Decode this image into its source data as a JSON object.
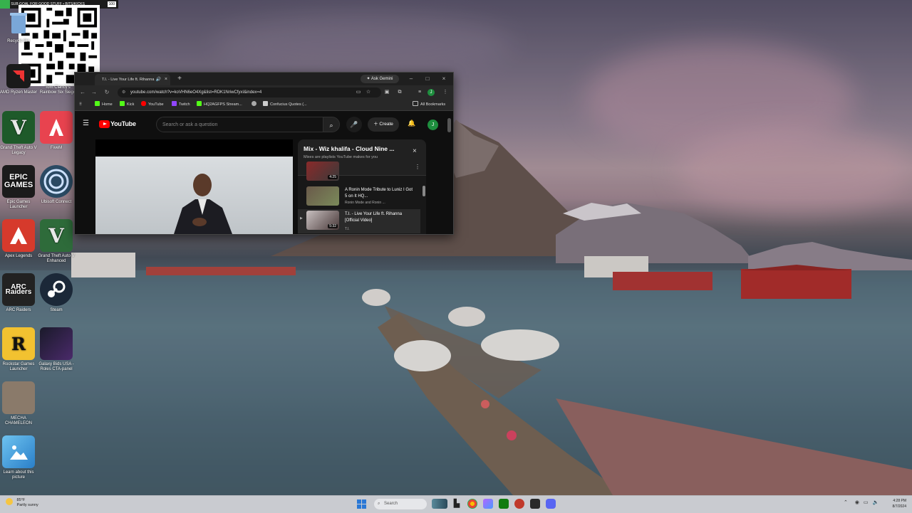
{
  "overlay": {
    "title": "SUB GOAL FOR GOOD STUFF • BITS/KICKS",
    "count": "100"
  },
  "desktop_icons": [
    {
      "label": "Recycle Bin",
      "color": "#5a7dbf"
    },
    {
      "label": "AMD Ryzen Master",
      "color": "#222"
    },
    {
      "label": "Tom Clancy's Rainbow Six Siege",
      "color": "#3a4a5a"
    },
    {
      "label": "Grand Theft Auto V Legacy",
      "color": "#2e7d32"
    },
    {
      "label": "FiveM",
      "color": "#e8434f"
    },
    {
      "label": "Epic Games Launcher",
      "color": "#1b1b1b"
    },
    {
      "label": "Ubisoft Connect",
      "color": "#2b4a63"
    },
    {
      "label": "Apex Legends",
      "color": "#d63a2c"
    },
    {
      "label": "Grand Theft Auto V Enhanced",
      "color": "#2e6b3a"
    },
    {
      "label": "ARC Raiders",
      "color": "#222"
    },
    {
      "label": "Steam",
      "color": "#1b2838"
    },
    {
      "label": "Rockstar Games Launcher",
      "color": "#f2c230"
    },
    {
      "label": "Galaxy Bids USA - Roles CTA-panel",
      "color": "#3a2a5a"
    },
    {
      "label": "MECHA CHAMELEON",
      "color": "#8a7a6a"
    },
    {
      "label": "Learn about this picture",
      "color": "#4aa3df"
    }
  ],
  "tile_text": {
    "epic": "EPIC GAMES",
    "arc": "ARC Raiders",
    "rockstar": "R"
  },
  "browser": {
    "tab_title": "T.I. - Live Your Life ft. Rihanna",
    "ask_gemini": "Ask Gemini",
    "url": "youtube.com/watch?v=koVHN6eO4Xg&list=RDK1NriwCfyxI&index=4",
    "bookmarks": [
      {
        "label": "Home",
        "color": "#53fc18"
      },
      {
        "label": "Kick",
        "color": "#53fc18"
      },
      {
        "label": "YouTube",
        "color": "#ff0000"
      },
      {
        "label": "Twitch",
        "color": "#9146ff"
      },
      {
        "label": "HQ2AGFPS Stream...",
        "color": "#53fc18"
      },
      {
        "label": "",
        "color": "#aaaaaa"
      },
      {
        "label": "Confucius Quotes (...",
        "color": "#cccccc"
      }
    ],
    "all_bookmarks": "All Bookmarks"
  },
  "youtube": {
    "logo": "YouTube",
    "search_placeholder": "Search or ask a question",
    "create": "Create",
    "avatar": "J",
    "mix": {
      "title": "Mix - Wiz khalifa - Cloud Nine ...",
      "subtitle": "Mixes are playlists YouTube makes for you",
      "items": [
        {
          "title": "",
          "channel": "",
          "duration": "4:25"
        },
        {
          "title": "A Ronin Mode Tribute to Luniz I Got 5 on It HQ...",
          "channel": "Ronin Mode and Ronin ...",
          "duration": ""
        },
        {
          "title": "T.I. - Live Your Life ft. Rihanna [Official Video]",
          "channel": "T.I.",
          "duration": "5:32"
        }
      ]
    }
  },
  "taskbar": {
    "weather_temp": "85°F",
    "weather_desc": "Partly sunny",
    "search": "Search",
    "time": "4:28 PM",
    "date": "8/7/2024"
  }
}
